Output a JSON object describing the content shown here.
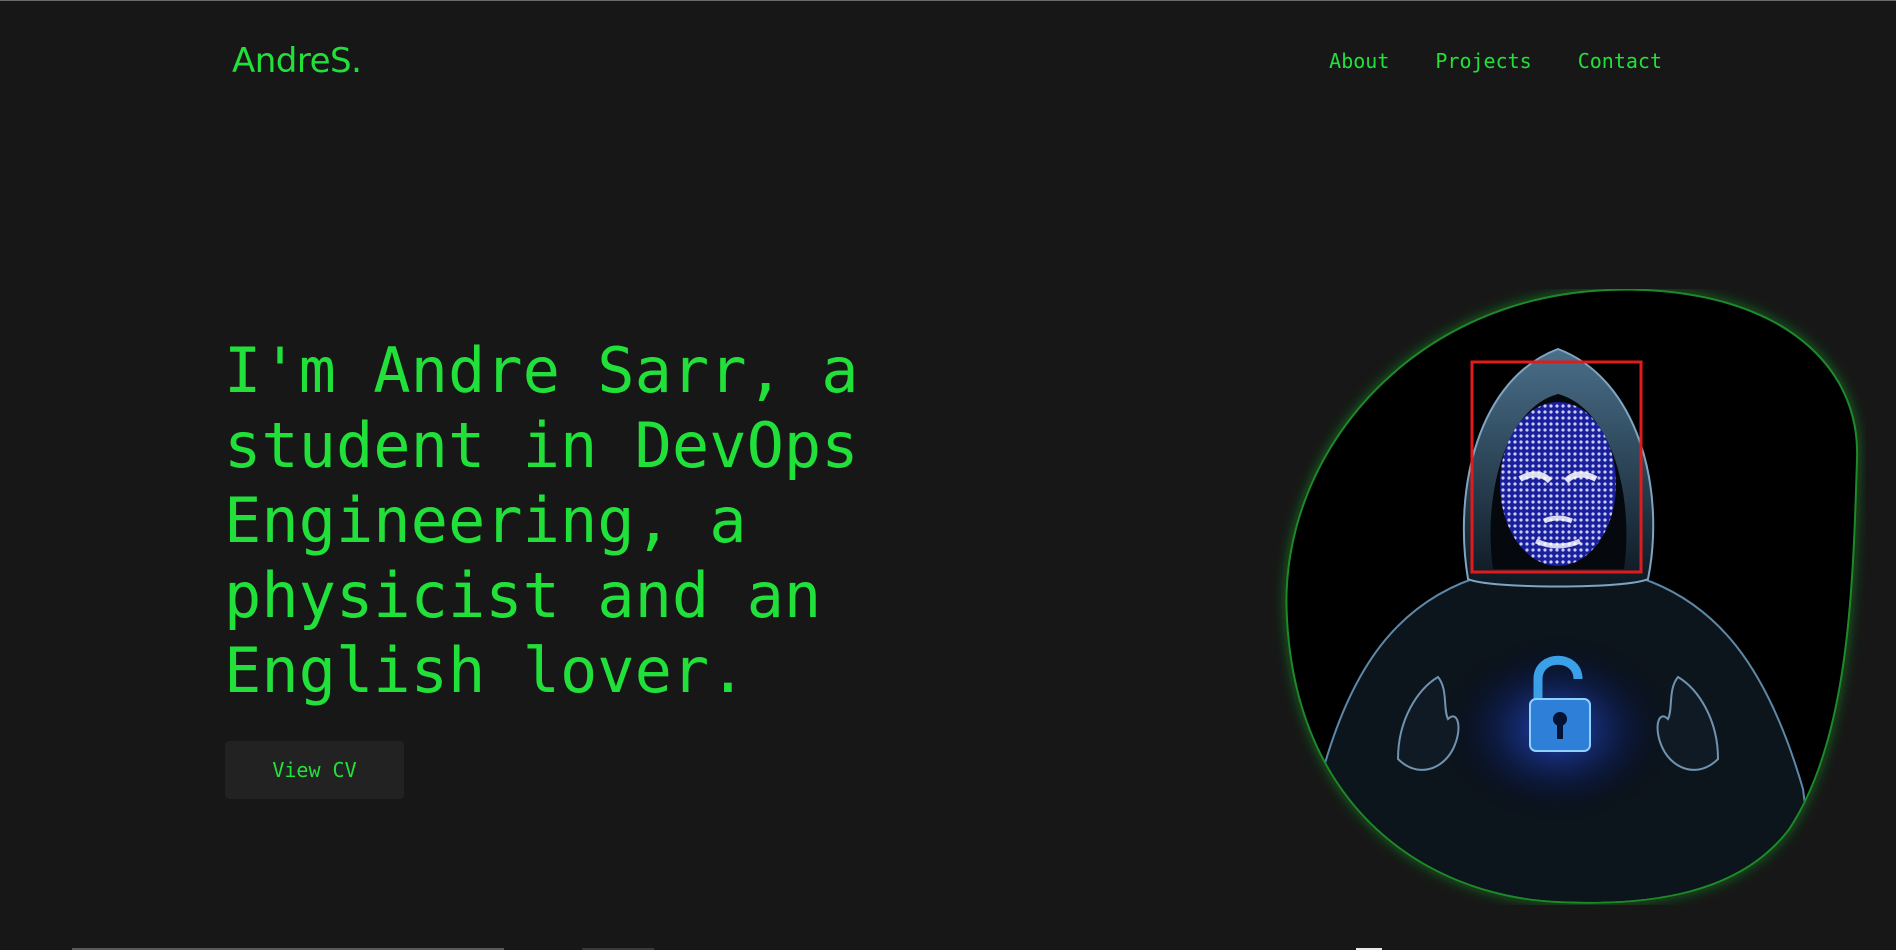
{
  "header": {
    "logo": "AndreS.",
    "nav": [
      "About",
      "Projects",
      "Contact"
    ]
  },
  "hero": {
    "headline": "I'm Andre Sarr, a student in DevOps Engineering, a physicist and an English lover.",
    "cta_label": "View CV"
  },
  "illustration": {
    "description_icon": "hooded-hacker-face-scan-icon",
    "colors": {
      "glow": "#1d8a2a",
      "scan_box": "#e01b1b",
      "face_mesh": "#3a3fd8",
      "lock": "#3aa0e8"
    }
  },
  "theme": {
    "background": "#171717",
    "accent": "#22e03a",
    "button_bg": "#222222"
  }
}
